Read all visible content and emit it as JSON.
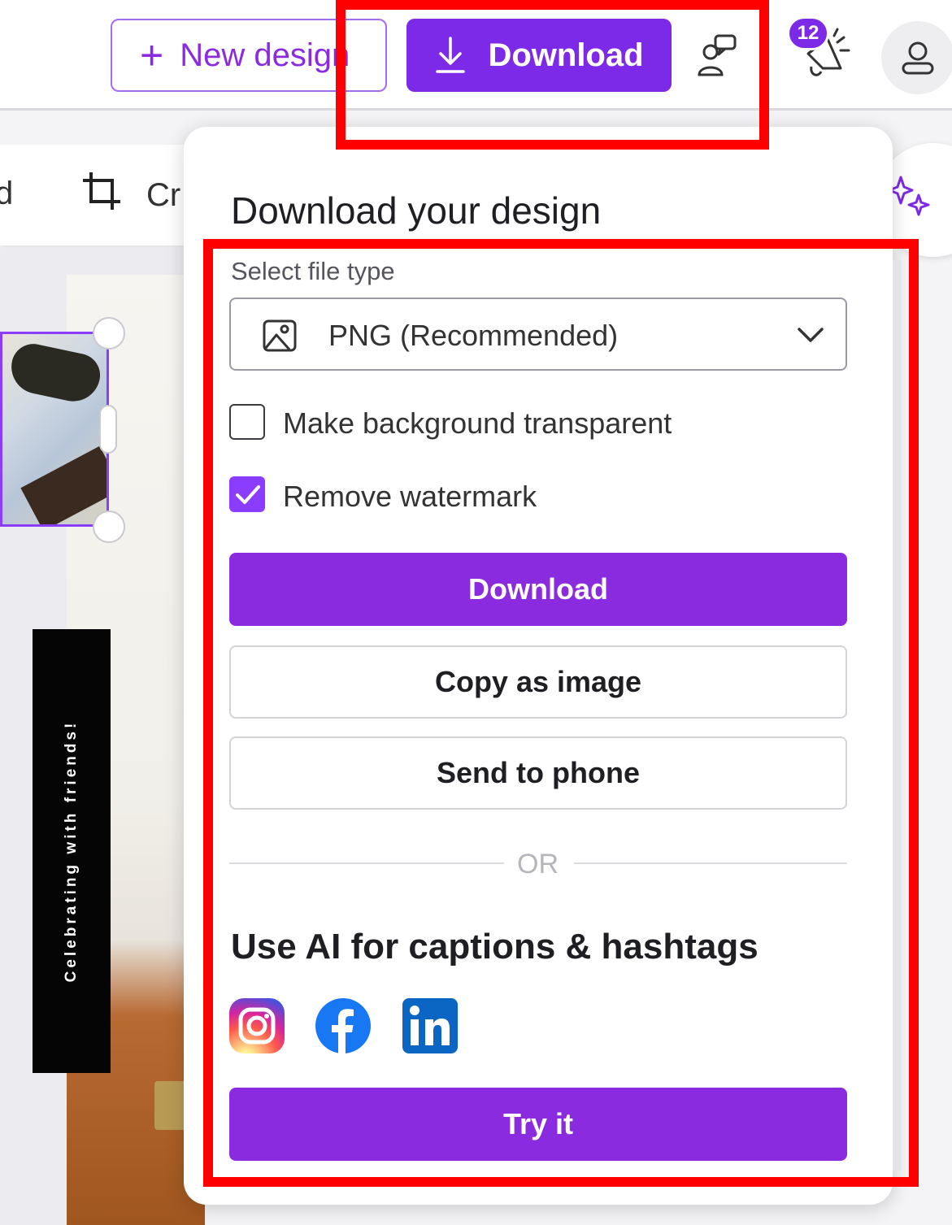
{
  "topbar": {
    "new_design_label": "New design",
    "download_label": "Download",
    "notification_count": "12"
  },
  "toolbar": {
    "crop_label": "Cr"
  },
  "design": {
    "banner_text": "Celebrating with friends!"
  },
  "download_panel": {
    "title": "Download your design",
    "file_type_label": "Select file type",
    "file_type_value": "PNG (Recommended)",
    "transparent_label": "Make background transparent",
    "transparent_checked": false,
    "watermark_label": "Remove watermark",
    "watermark_checked": true,
    "download_button": "Download",
    "copy_button": "Copy as image",
    "send_button": "Send to phone",
    "or_text": "OR",
    "ai_heading": "Use AI for captions & hashtags",
    "social_icons": [
      "instagram-icon",
      "facebook-icon",
      "linkedin-icon"
    ],
    "try_button": "Try it"
  },
  "colors": {
    "accent": "#8b2bdf",
    "top_download": "#7d2ae8",
    "highlight": "#ff0000"
  }
}
